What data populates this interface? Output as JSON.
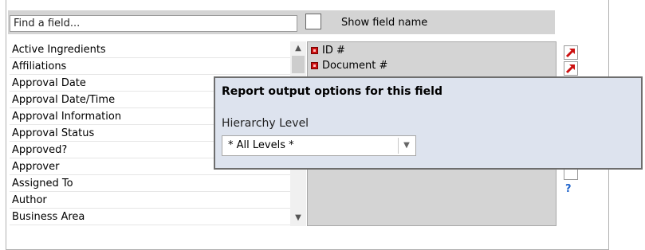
{
  "search": {
    "placeholder": "Find a field...",
    "value": ""
  },
  "show_field_name": {
    "label": "Show field name",
    "checked": false
  },
  "available_fields": [
    "Active Ingredients",
    "Affiliations",
    "Approval Date",
    "Approval Date/Time",
    "Approval Information",
    "Approval Status",
    "Approved?",
    "Approver",
    "Assigned To",
    "Author",
    "Business Area"
  ],
  "selected_fields": [
    "ID #",
    "Document #"
  ],
  "help_label": "?",
  "popup": {
    "title": "Report output options for this field",
    "hierarchy_label": "Hierarchy Level",
    "hierarchy_value": "* All Levels *"
  },
  "colors": {
    "bullet": "#cc1111",
    "popup_bg": "#dde3ee",
    "help": "#2266cc"
  }
}
